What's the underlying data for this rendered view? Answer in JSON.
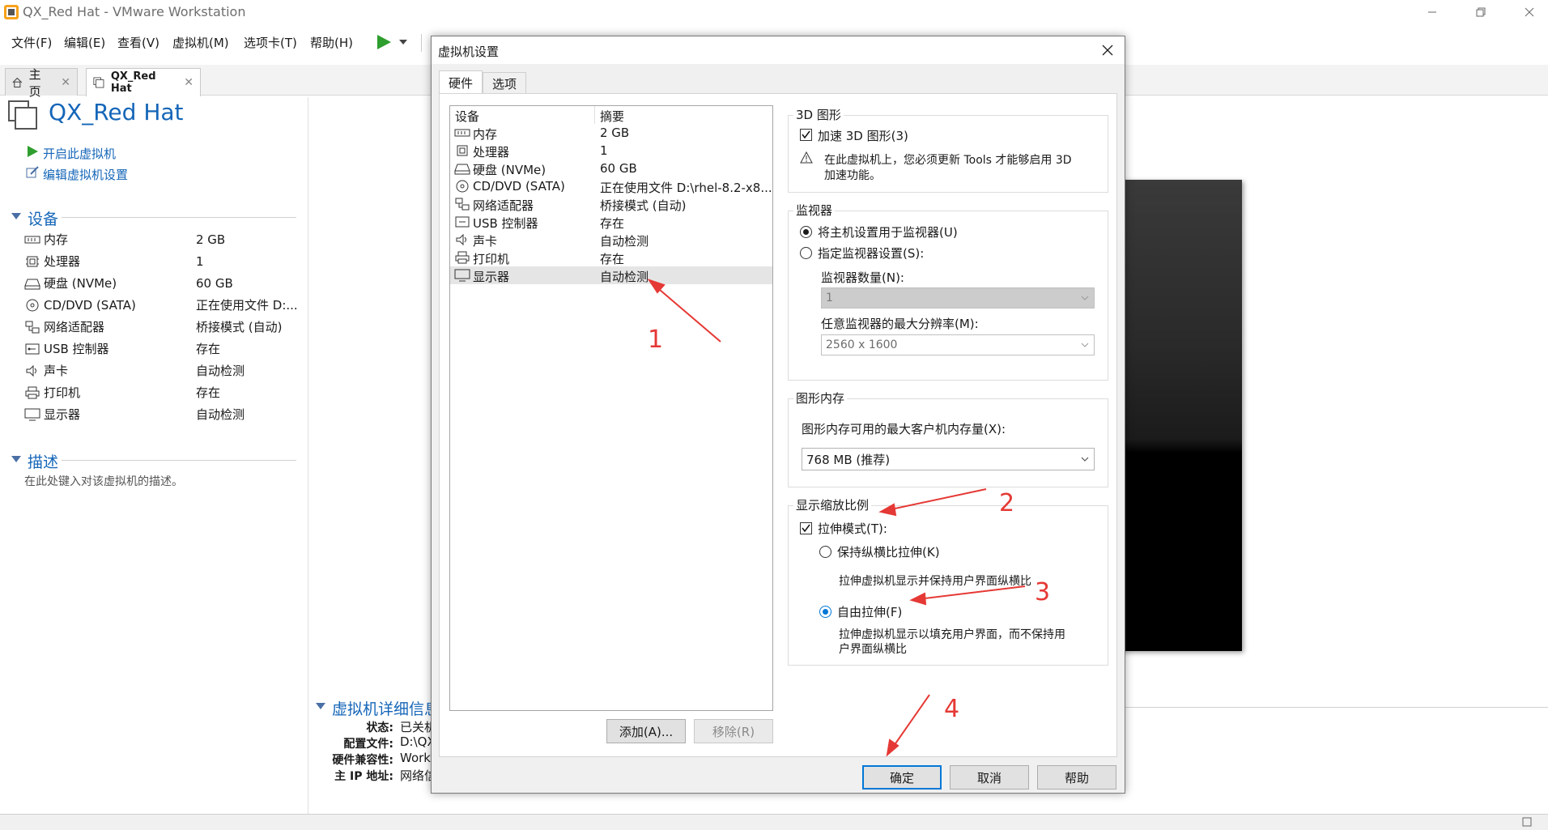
{
  "window": {
    "title": "QX_Red Hat - VMware Workstation"
  },
  "menu": [
    "文件(F)",
    "编辑(E)",
    "查看(V)",
    "虚拟机(M)",
    "选项卡(T)",
    "帮助(H)"
  ],
  "tabs": [
    {
      "label": "主页"
    },
    {
      "label": "QX_Red Hat"
    }
  ],
  "vm": {
    "name": "QX_Red Hat",
    "actions": {
      "power_on": "开启此虚拟机",
      "edit_settings": "编辑虚拟机设置"
    },
    "devices_title": "设备",
    "devices": [
      {
        "name": "内存",
        "value": "2 GB",
        "icon": "memory-icon"
      },
      {
        "name": "处理器",
        "value": "1",
        "icon": "cpu-icon"
      },
      {
        "name": "硬盘 (NVMe)",
        "value": "60 GB",
        "icon": "hard-disk-icon"
      },
      {
        "name": "CD/DVD (SATA)",
        "value": "正在使用文件 D:...",
        "icon": "cd-dvd-icon"
      },
      {
        "name": "网络适配器",
        "value": "桥接模式 (自动)",
        "icon": "network-icon"
      },
      {
        "name": "USB 控制器",
        "value": "存在",
        "icon": "usb-icon"
      },
      {
        "name": "声卡",
        "value": "自动检测",
        "icon": "speaker-icon"
      },
      {
        "name": "打印机",
        "value": "存在",
        "icon": "printer-icon"
      },
      {
        "name": "显示器",
        "value": "自动检测",
        "icon": "display-icon"
      }
    ],
    "description_title": "描述",
    "description_placeholder": "在此处键入对该虚拟机的描述。",
    "details_title": "虚拟机详细信息",
    "details": [
      {
        "label": "状态:",
        "value": "已关机"
      },
      {
        "label": "配置文件:",
        "value": "D:\\QX"
      },
      {
        "label": "硬件兼容性:",
        "value": "Work"
      },
      {
        "label": "主 IP 地址:",
        "value": "网络信"
      }
    ]
  },
  "dialog": {
    "title": "虚拟机设置",
    "tabs": [
      "硬件",
      "选项"
    ],
    "list_headers": [
      "设备",
      "摘要"
    ],
    "hardware": [
      {
        "name": "内存",
        "summary": "2 GB",
        "icon": "memory-icon"
      },
      {
        "name": "处理器",
        "summary": "1",
        "icon": "cpu-icon"
      },
      {
        "name": "硬盘 (NVMe)",
        "summary": "60 GB",
        "icon": "hard-disk-icon"
      },
      {
        "name": "CD/DVD (SATA)",
        "summary": "正在使用文件 D:\\rhel-8.2-x8...",
        "icon": "cd-dvd-icon"
      },
      {
        "name": "网络适配器",
        "summary": "桥接模式 (自动)",
        "icon": "network-icon"
      },
      {
        "name": "USB 控制器",
        "summary": "存在",
        "icon": "usb-icon"
      },
      {
        "name": "声卡",
        "summary": "自动检测",
        "icon": "speaker-icon"
      },
      {
        "name": "打印机",
        "summary": "存在",
        "icon": "printer-icon"
      },
      {
        "name": "显示器",
        "summary": "自动检测",
        "icon": "display-icon",
        "selected": true
      }
    ],
    "add_button": "添加(A)...",
    "remove_button": "移除(R)",
    "g3d": {
      "title": "3D 图形",
      "accelerate": "加速 3D 图形(3)",
      "warning": "在此虚拟机上，您必须更新 Tools 才能够启用 3D",
      "warning2": "加速功能。"
    },
    "monitor": {
      "title": "监视器",
      "use_host": "将主机设置用于监视器(U)",
      "specify": "指定监视器设置(S):",
      "count_label": "监视器数量(N):",
      "count_value": "1",
      "maxres_label": "任意监视器的最大分辨率(M):",
      "maxres_value": "2560 x 1600"
    },
    "gmem": {
      "title": "图形内存",
      "label": "图形内存可用的最大客户机内存量(X):",
      "value": "768 MB (推荐)"
    },
    "scaling": {
      "title": "显示缩放比例",
      "stretch": "拉伸模式(T):",
      "keep_aspect": "保持纵横比拉伸(K)",
      "keep_aspect_desc": "拉伸虚拟机显示并保持用户界面纵横比",
      "free": "自由拉伸(F)",
      "free_desc": "拉伸虚拟机显示以填充用户界面，而不保持用",
      "free_desc2": "户界面纵横比"
    },
    "ok": "确定",
    "cancel": "取消",
    "help": "帮助"
  },
  "annotations": [
    "1",
    "2",
    "3",
    "4"
  ],
  "colors": {
    "accent": "#1566b8",
    "annotation": "#e53935",
    "default_button": "#0078d7"
  }
}
